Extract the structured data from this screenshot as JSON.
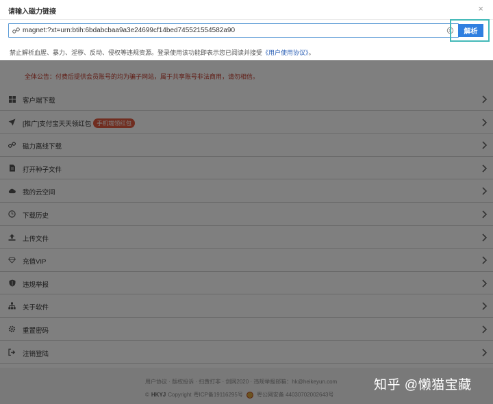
{
  "dialog": {
    "title": "请输入磁力链接",
    "close_glyph": "×",
    "input_value": "magnet:?xt=urn:btih:6bdabcbaa9a3e24699cf14bed745521554582a90",
    "parse_label": "解析",
    "tip_text": "禁止解析血腥、暴力、淫秽、反动、侵权等违规资源。登录使用该功能即表示您已阅读并接受",
    "agreement_link": "《用户使用协议》",
    "tip_end": "。"
  },
  "notice": {
    "text": "全体公告：付费后提供会员账号的均为骗子网站，属于共享账号非法商用，请勿相信。"
  },
  "menu": {
    "items": [
      {
        "label": "客户端下载",
        "icon": "windows-icon"
      },
      {
        "label": "[推广]支付宝天天领红包",
        "badge": "手机端领红包",
        "icon": "rocket-icon"
      },
      {
        "label": "磁力离线下载",
        "icon": "magnet-link-icon"
      },
      {
        "label": "打开种子文件",
        "icon": "file-icon"
      },
      {
        "label": "我的云空间",
        "icon": "cloud-icon"
      },
      {
        "label": "下载历史",
        "icon": "clock-icon"
      },
      {
        "label": "上传文件",
        "icon": "upload-icon"
      },
      {
        "label": "充值VIP",
        "icon": "diamond-icon"
      },
      {
        "label": "违规举报",
        "icon": "shield-icon"
      },
      {
        "label": "关于软件",
        "icon": "sitemap-icon"
      },
      {
        "label": "重置密码",
        "icon": "gear-icon"
      },
      {
        "label": "注销登陆",
        "icon": "sign-out-icon"
      }
    ]
  },
  "footer": {
    "links": [
      "用户协议",
      "版权投诉",
      "扫黄打非",
      "剑网2020",
      "违规举报邮箱：hk@heikeyun.com"
    ],
    "copyright_symbol": "©",
    "brand": "HKYJ",
    "copyright_text": "Copyright",
    "icp": "粤ICP备19116295号",
    "police": "粤公网安备 44030702002643号"
  },
  "watermark": "知乎 @懒猫宝藏"
}
